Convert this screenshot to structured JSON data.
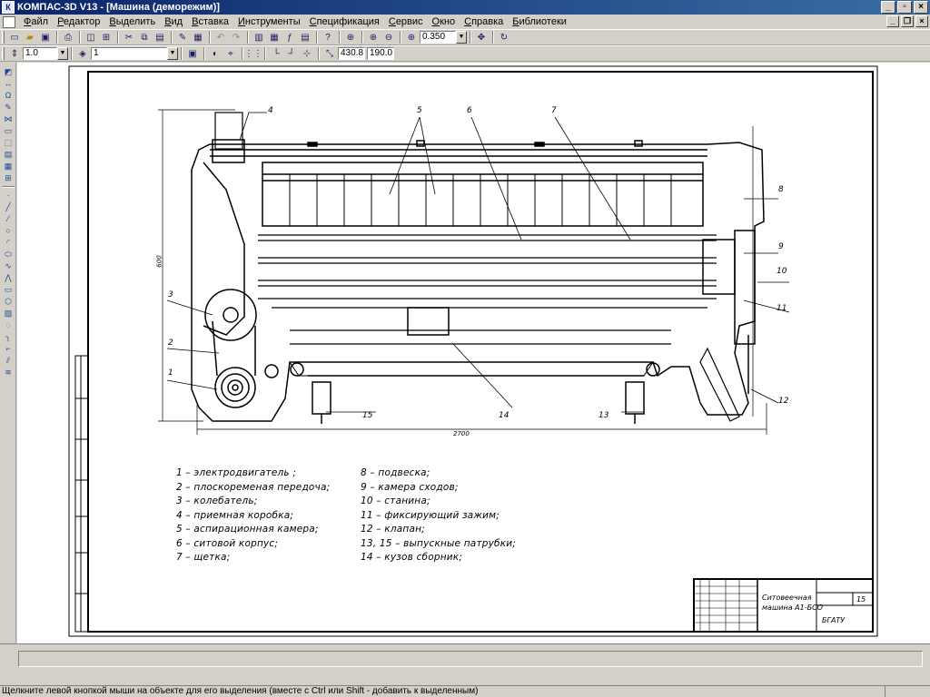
{
  "window": {
    "title": "КОМПАС-3D V13 - [Машина (деморежим)]",
    "app_icon": "kompas-logo-icon"
  },
  "menu": [
    "Файл",
    "Редактор",
    "Выделить",
    "Вид",
    "Вставка",
    "Инструменты",
    "Спецификация",
    "Сервис",
    "Окно",
    "Справка",
    "Библиотеки"
  ],
  "toolbar": {
    "zoom_value": "0.350",
    "step_value": "1.0",
    "layer_value": "1",
    "coord_x": "430.8",
    "coord_y": "190.0"
  },
  "drawing": {
    "callouts": [
      "4",
      "5",
      "6",
      "7",
      "8",
      "9",
      "10",
      "11",
      "3",
      "2",
      "1",
      "15",
      "14",
      "13",
      "12"
    ],
    "dim_height": "600",
    "dim_width": "2700",
    "legend_left": [
      "1 – электродвигатель   ;",
      "2 – плоскоременая передоча;",
      "3 – колебатель;",
      "4 – приемная коробка;",
      "5 – аспирационная камера;",
      "6 – ситовой корпус;",
      "7 – щетка;"
    ],
    "legend_right": [
      "8 – подвеска;",
      "9 – камера сходов;",
      "10 – станина;",
      "11 – фиксирующий зажим;",
      "12 – клапан;",
      "13, 15 – выпускные патрубки;",
      "14 – кузов сборник;"
    ],
    "stamp": {
      "title_line1": "Ситовеечная",
      "title_line2": "машина  А1-БСО",
      "sheet": "15",
      "org": "БГАТУ"
    }
  },
  "statusbar": {
    "hint": "Щелкните левой кнопкой мыши на объекте для его выделения (вместе с Ctrl или Shift - добавить к выделенным)"
  }
}
